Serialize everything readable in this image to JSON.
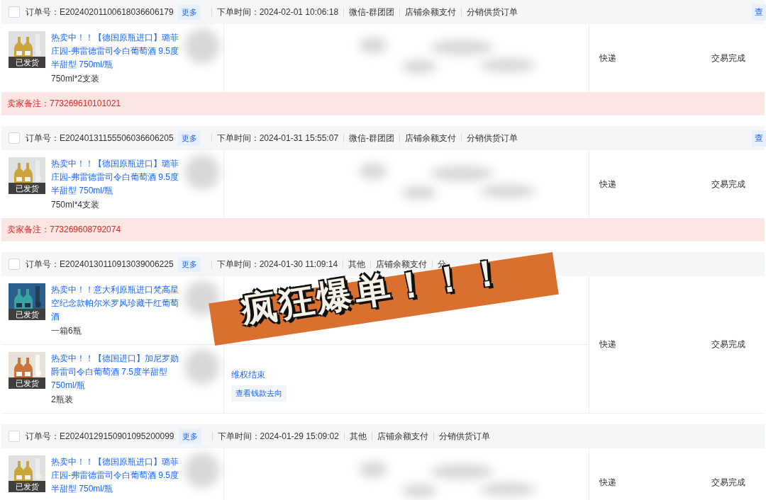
{
  "orders": [
    {
      "checked": false,
      "order_label": "订单号：",
      "order_no": "E20240201100618036606179",
      "more": "更多",
      "time_label": "下单时间：",
      "time": "2024-02-01 10:06:18",
      "channel": "微信-群团团",
      "payment": "店铺余额支付",
      "order_type": "分销供货订单",
      "view_button": "查",
      "items": [
        {
          "image_label": "已发货",
          "title": "热卖中！！【德国原瓶进口】璐菲庄园-弗雷德雷司令白葡萄酒 9.5度半甜型 750ml/瓶",
          "spec": "750ml*2支装"
        }
      ],
      "delivery": "快递",
      "status": "交易完成",
      "remark": {
        "label": "卖家备注：",
        "value": "773269610101021"
      }
    },
    {
      "checked": false,
      "order_label": "订单号：",
      "order_no": "E20240131155506036606205",
      "more": "更多",
      "time_label": "下单时间：",
      "time": "2024-01-31 15:55:07",
      "channel": "微信-群团团",
      "payment": "店铺余额支付",
      "order_type": "分销供货订单",
      "view_button": "查",
      "items": [
        {
          "image_label": "已发货",
          "title": "热卖中！！【德国原瓶进口】璐菲庄园-弗雷德雷司令白葡萄酒 9.5度半甜型 750ml/瓶",
          "spec": "750ml*4支装"
        }
      ],
      "delivery": "快递",
      "status": "交易完成",
      "remark": {
        "label": "卖家备注：",
        "value": "773269608792074"
      }
    },
    {
      "checked": false,
      "order_label": "订单号：",
      "order_no": "E20240130110913039006225",
      "more": "更多",
      "time_label": "下单时间：",
      "time": "2024-01-30 11:09:14",
      "channel": "其他",
      "payment": "店铺余额支付",
      "order_type": "分",
      "items": [
        {
          "image_label": "已发货",
          "title": "热卖中！！意大利原瓶进口梵高星空纪念款帕尔米罗风珍藏干红葡萄酒",
          "spec": "一箱6瓶"
        },
        {
          "image_label": "已发货",
          "title": "热卖中！！【德国进口】加尼罗勋爵雷司令白葡萄酒 7.5度半甜型 750ml/瓶",
          "spec": "2瓶装",
          "after_sale": {
            "status": "维权结束",
            "button": "查看钱款去向"
          }
        }
      ],
      "delivery": "快递",
      "status": "交易完成"
    },
    {
      "checked": false,
      "order_label": "订单号：",
      "order_no": "E20240129150901095200099",
      "more": "更多",
      "time_label": "下单时间：",
      "time": "2024-01-29 15:09:02",
      "channel": "其他",
      "payment": "店铺余额支付",
      "order_type": "分销供货订单",
      "items": [
        {
          "image_label": "已发货",
          "title": "热卖中！！【德国原瓶进口】璐菲庄园-弗雷德雷司令白葡萄酒 9.5度半甜型 750ml/瓶"
        }
      ],
      "delivery": "快递",
      "status": "交易完成"
    }
  ],
  "sticker": {
    "text": "疯狂爆单！！！"
  }
}
